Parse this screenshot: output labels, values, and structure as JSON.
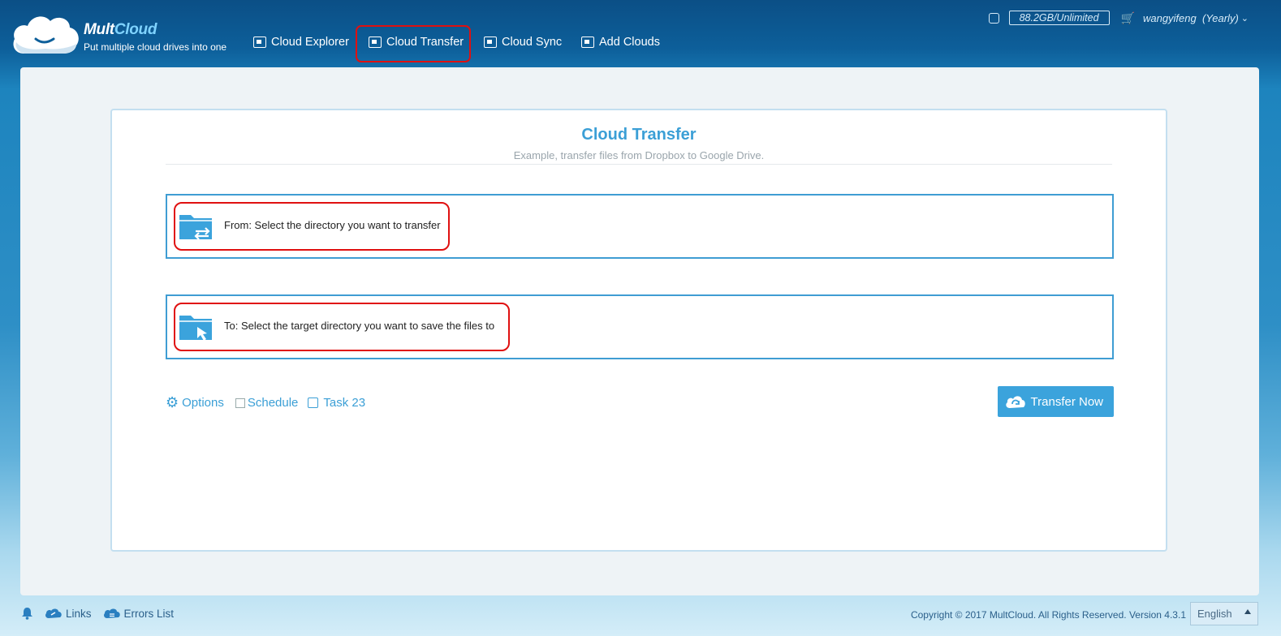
{
  "brand": {
    "name_part1": "Mult",
    "name_part2": "Cloud",
    "tagline": "Put multiple cloud drives into one"
  },
  "nav": {
    "items": [
      {
        "label": "Cloud Explorer",
        "icon": "explorer-icon"
      },
      {
        "label": "Cloud Transfer",
        "icon": "transfer-icon"
      },
      {
        "label": "Cloud Sync",
        "icon": "sync-icon"
      },
      {
        "label": "Add Clouds",
        "icon": "add-cloud-icon"
      }
    ],
    "active": "Cloud Transfer"
  },
  "account": {
    "quota": "88.2GB/Unlimited",
    "username": "wangyifeng",
    "plan": "(Yearly)"
  },
  "transfer": {
    "title": "Cloud Transfer",
    "subtitle": "Example, transfer files from Dropbox to Google Drive.",
    "from_text": "From: Select the directory you want to transfer",
    "to_text": "To: Select the target directory you want to save the files to",
    "options_label": "Options",
    "schedule_label": "Schedule",
    "task_label": "Task 23",
    "button_label": "Transfer Now"
  },
  "footer": {
    "links_label": "Links",
    "errors_label": "Errors List",
    "copyright": "Copyright © 2017 MultCloud. All Rights Reserved. Version 4.3.1",
    "language": "English"
  },
  "colors": {
    "accent": "#3ba3dc",
    "highlight": "#e01010",
    "header_bg": "#0b4f86"
  }
}
